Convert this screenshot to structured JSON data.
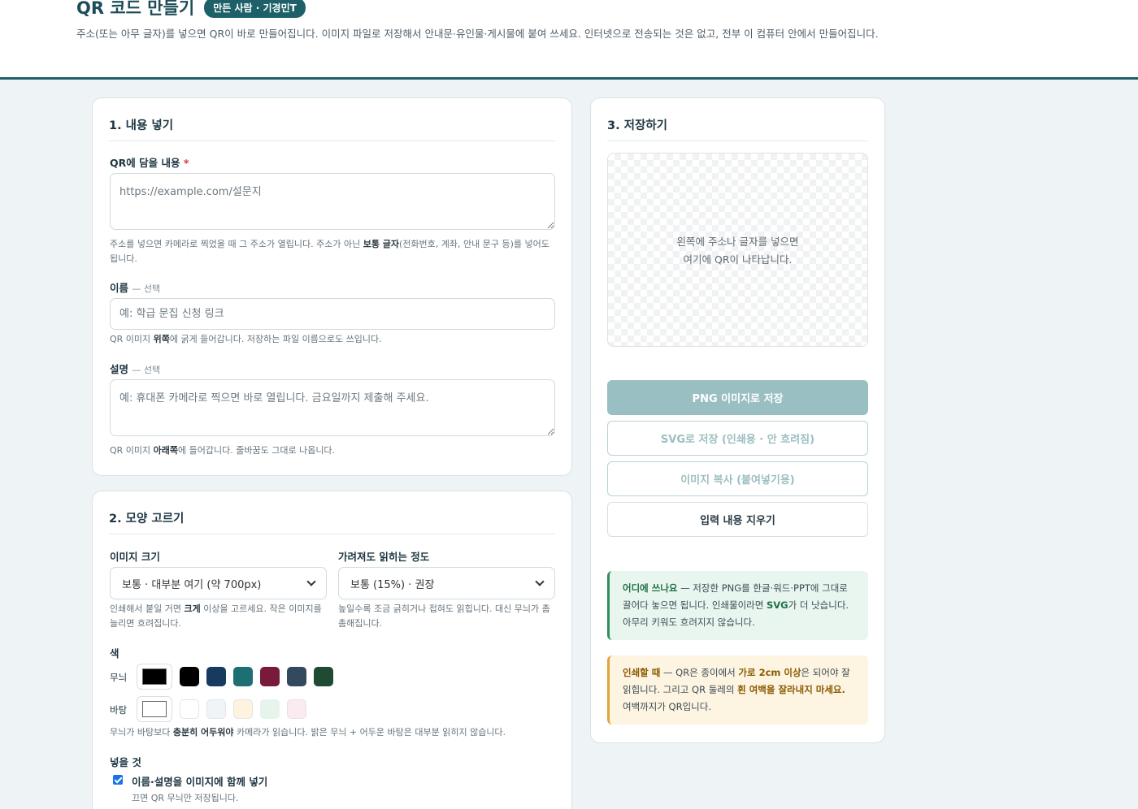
{
  "header": {
    "title": "QR 코드 만들기",
    "badge": "만든 사람 · 기경민T",
    "intro": "주소(또는 아무 글자)를 넣으면 QR이 바로 만들어집니다. 이미지 파일로 저장해서 안내문·유인물·게시물에 붙여 쓰세요. 인터넷으로 전송되는 것은 없고, 전부 이 컴퓨터 안에서 만들어집니다."
  },
  "content_card": {
    "title": "1. 내용 넣기",
    "content_label": "QR에 담을 내용",
    "required_mark": "*",
    "content_placeholder": "https://example.com/설문지",
    "content_hint_a": "주소를 넣으면 카메라로 찍었을 때 그 주소가 열립니다. 주소가 아닌 ",
    "content_hint_b": "보통 글자",
    "content_hint_c": "(전화번호, 계좌, 안내 문구 등)를 넣어도 됩니다.",
    "name_label": "이름",
    "optional_tag": "— 선택",
    "name_placeholder": "예: 학급 문집 신청 링크",
    "name_hint_a": "QR 이미지 ",
    "name_hint_b": "위쪽",
    "name_hint_c": "에 굵게 들어갑니다. 저장하는 파일 이름으로도 쓰입니다.",
    "desc_label": "설명",
    "desc_placeholder": "예: 휴대폰 카메라로 찍으면 바로 열립니다. 금요일까지 제출해 주세요.",
    "desc_hint_a": "QR 이미지 ",
    "desc_hint_b": "아래쪽",
    "desc_hint_c": "에 들어갑니다. 줄바꿈도 그대로 나옵니다."
  },
  "style_card": {
    "title": "2. 모양 고르기",
    "size_label": "이미지 크기",
    "size_value": "보통 · 대부분 여기 (약 700px)",
    "size_hint_a": "인쇄해서 붙일 거면 ",
    "size_hint_b": "크게",
    "size_hint_c": " 이상을 고르세요. 작은 이미지를 늘리면 흐려집니다.",
    "ec_label": "가려져도 읽히는 정도",
    "ec_value": "보통 (15%) · 권장",
    "ec_hint": "높일수록 조금 긁히거나 접혀도 읽힙니다. 대신 무늬가 촘촘해집니다.",
    "color_label": "색",
    "fg_label": "무늬",
    "bg_label": "바탕",
    "fg_current": "#000000",
    "bg_current": "#ffffff",
    "fg_swatches": [
      "#000000",
      "#173a5e",
      "#1e6f73",
      "#7a1a3a",
      "#334a5e",
      "#1f4a33"
    ],
    "bg_swatches": [
      "#ffffff",
      "#f1f4f7",
      "#fdf3df",
      "#e6f4ec",
      "#fbeaf0"
    ],
    "color_hint_a": "무늬가 바탕보다 ",
    "color_hint_b": "충분히 어두워야",
    "color_hint_c": " 카메라가 읽습니다. 밝은 무늬 + 어두운 바탕은 대부분 읽히지 않습니다.",
    "include_label": "넣을 것",
    "include_option": "이름·설명을 이미지에 함께 넣기",
    "include_checked": true,
    "include_hint": "끄면 QR 무늬만 저장됩니다."
  },
  "save_card": {
    "title": "3. 저장하기",
    "preview_line1": "왼쪽에 주소나 글자를 넣으면",
    "preview_line2": "여기에 QR이 나타납니다.",
    "btn_png": "PNG 이미지로 저장",
    "btn_svg": "SVG로 저장 (인쇄용 · 안 흐려짐)",
    "btn_copy": "이미지 복사 (붙여넣기용)",
    "btn_clear": "입력 내용 지우기",
    "note1_b1": "어디에 쓰나요",
    "note1_t1": " — 저장한 PNG를 한글·워드·PPT에 그대로 끌어다 놓으면 됩니다. 인쇄물이라면 ",
    "note1_b2": "SVG",
    "note1_t2": "가 더 낫습니다. 아무리 키워도 흐려지지 않습니다.",
    "note2_b1": "인쇄할 때",
    "note2_t1": " — QR은 종이에서 ",
    "note2_b2": "가로 2cm 이상",
    "note2_t2": "은 되어야 잘 읽힙니다. 그리고 QR 둘레의 ",
    "note2_b3": "흰 여백을 잘라내지 마세요.",
    "note2_t3": " 여백까지가 QR입니다."
  }
}
